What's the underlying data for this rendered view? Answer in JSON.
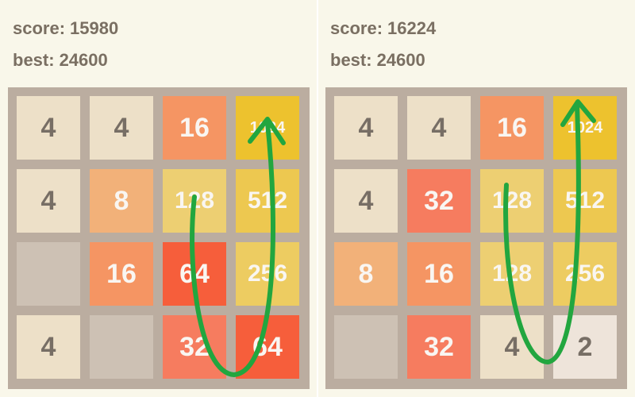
{
  "colors": {
    "background": "#f9f7ea",
    "board": "#bbada0",
    "empty_cell": "#cdc1b4",
    "score_text": "#7a6f62",
    "swipe_arrow": "#22a63f"
  },
  "boards": [
    {
      "score_label": "score:",
      "score": "15980",
      "best_label": "best:",
      "best": "24600",
      "grid": [
        [
          "4",
          "4",
          "16",
          "1024"
        ],
        [
          "4",
          "8",
          "128",
          "512"
        ],
        [
          "",
          "16",
          "64",
          "256"
        ],
        [
          "4",
          "",
          "32",
          "64"
        ]
      ],
      "swipe_gesture": "u-turn-up"
    },
    {
      "score_label": "score:",
      "score": "16224",
      "best_label": "best:",
      "best": "24600",
      "grid": [
        [
          "4",
          "4",
          "16",
          "1024"
        ],
        [
          "4",
          "32",
          "128",
          "512"
        ],
        [
          "8",
          "16",
          "128",
          "256"
        ],
        [
          "",
          "32",
          "4",
          "2"
        ]
      ],
      "swipe_gesture": "u-turn-up"
    }
  ]
}
